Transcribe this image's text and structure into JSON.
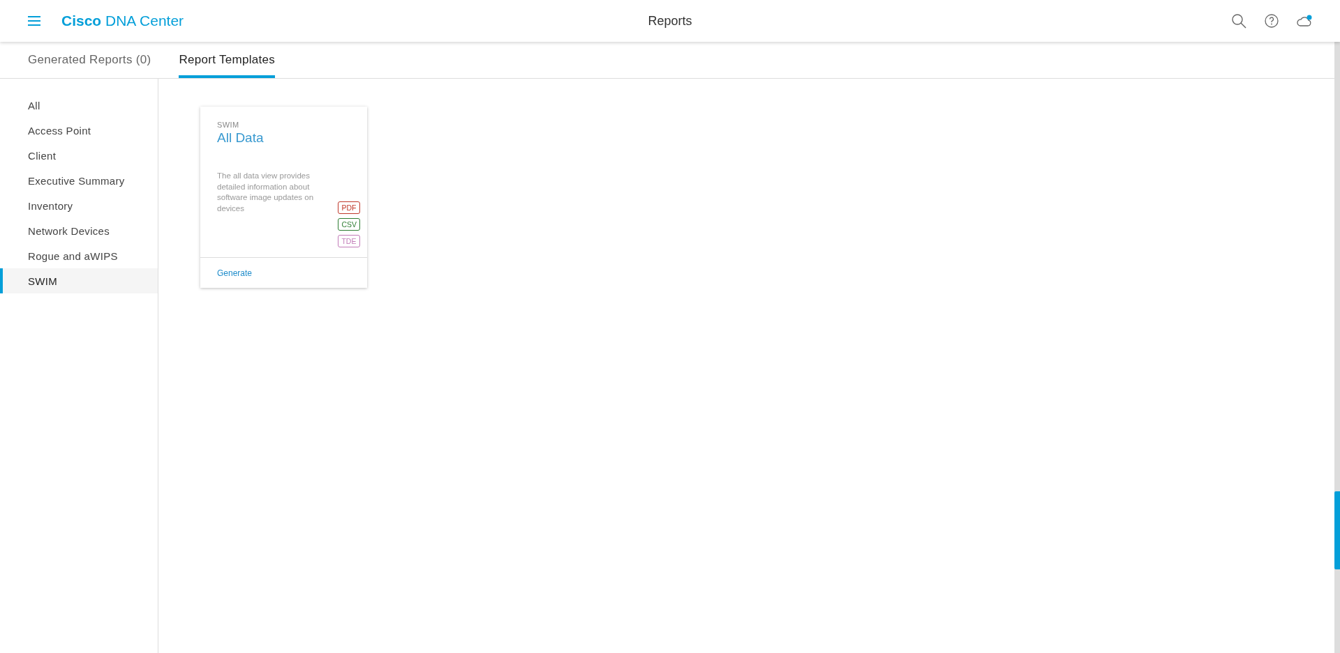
{
  "header": {
    "brand": "**Cisco** DNA Center",
    "title": "Reports",
    "notification": true
  },
  "tabs": [
    {
      "label": "Generated Reports (0)",
      "selected": false
    },
    {
      "label": "Report Templates",
      "selected": true
    }
  ],
  "sidebar": {
    "items": [
      {
        "label": "All",
        "selected": false
      },
      {
        "label": "Access Point",
        "selected": false
      },
      {
        "label": "Client",
        "selected": false
      },
      {
        "label": "Executive Summary",
        "selected": false
      },
      {
        "label": "Inventory",
        "selected": false
      },
      {
        "label": "Network Devices",
        "selected": false
      },
      {
        "label": "Rogue and aWIPS",
        "selected": false
      },
      {
        "label": "SWIM",
        "selected": true
      }
    ]
  },
  "cards": [
    {
      "category": "SWIM",
      "title": "All Data",
      "description": "The all data view provides detailed information about software image updates on devices",
      "formats": [
        {
          "label": "PDF",
          "color": "#c0392b"
        },
        {
          "label": "CSV",
          "color": "#2e7d32"
        },
        {
          "label": "TDE",
          "color": "#c27bb8"
        }
      ],
      "action": "Generate"
    }
  ]
}
